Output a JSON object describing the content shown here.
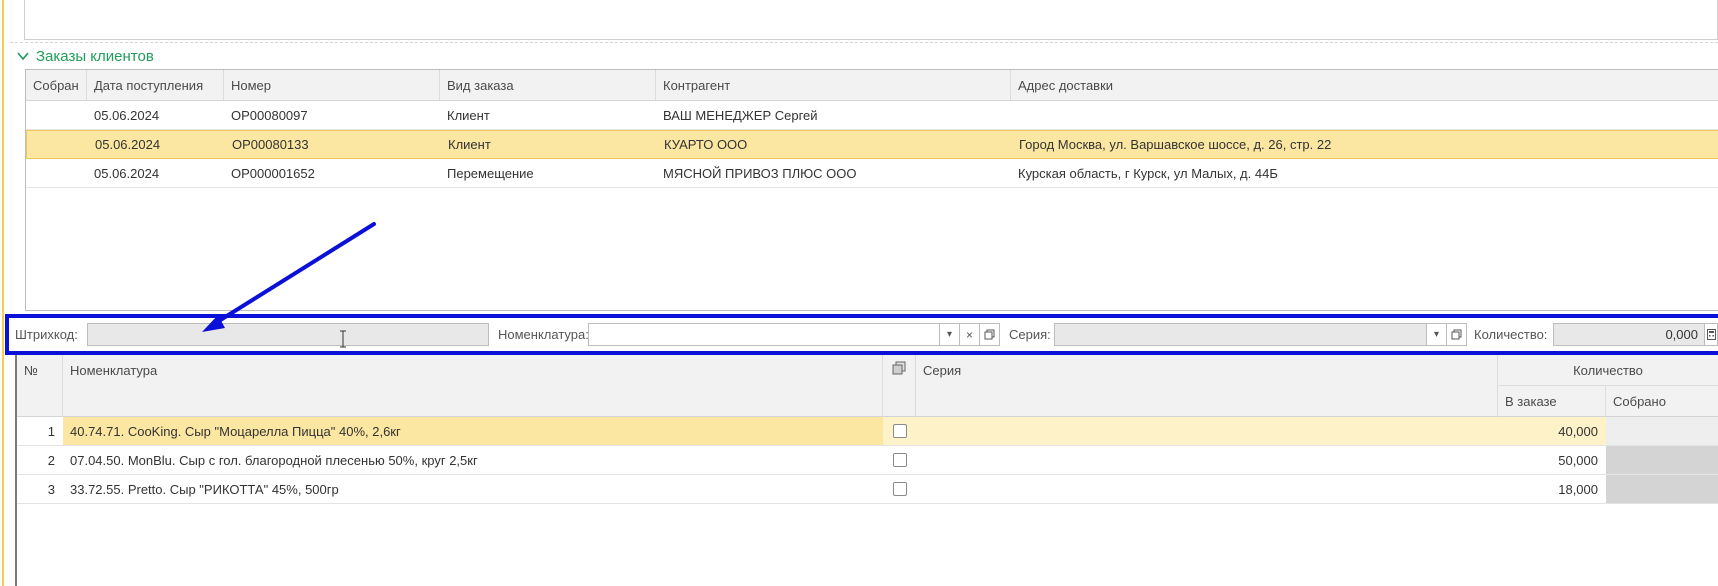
{
  "colors": {
    "accent_green": "#1e9e5a",
    "selection_yellow": "#fbe7a1",
    "highlight_blue": "#0a10d8"
  },
  "group": {
    "title": "Заказы клиентов"
  },
  "orders": {
    "columns": [
      "Собран",
      "Дата поступления",
      "Номер",
      "Вид заказа",
      "Контрагент",
      "Адрес доставки"
    ],
    "rows": [
      {
        "sobran": "",
        "date": "05.06.2024",
        "number": "ОР00080097",
        "type": "Клиент",
        "contractor": "ВАШ МЕНЕДЖЕР Сергей",
        "address": ""
      },
      {
        "sobran": "",
        "date": "05.06.2024",
        "number": "ОР00080133",
        "type": "Клиент",
        "contractor": "КУАРТО ООО",
        "address": "Город Москва, ул. Варшавское шоссе, д. 26, стр. 22"
      },
      {
        "sobran": "",
        "date": "05.06.2024",
        "number": "ОР000001652",
        "type": "Перемещение",
        "contractor": "МЯСНОЙ ПРИВОЗ ПЛЮС ООО",
        "address": "Курская область, г Курск, ул Малых, д. 44Б"
      }
    ],
    "selected_index": 1
  },
  "filter": {
    "barcode_label": "Штрихкод:",
    "barcode_value": "",
    "nomenclature_label": "Номенклатура:",
    "nomenclature_value": "",
    "series_label": "Серия:",
    "series_value": "",
    "quantity_label": "Количество:",
    "quantity_value": "0,000",
    "icons": [
      "chevron-down-icon",
      "clear-icon",
      "open-icon",
      "calculator-icon"
    ]
  },
  "items": {
    "col_num": "№",
    "col_nomenclature": "Номенклатура",
    "col_series": "Серия",
    "col_quantity": "Количество",
    "col_in_order": "В заказе",
    "col_collected": "Собрано",
    "rows": [
      {
        "num": "1",
        "nomenclature": "40.74.71. CooKing. Сыр \"Моцарелла Пицца\" 40%, 2,6кг",
        "series": "",
        "in_order": "40,000",
        "collected": ""
      },
      {
        "num": "2",
        "nomenclature": "07.04.50. MonBlu. Сыр с гол. благородной плесенью 50%, круг 2,5кг",
        "series": "",
        "in_order": "50,000",
        "collected": ""
      },
      {
        "num": "3",
        "nomenclature": "33.72.55. Pretto. Сыр \"РИКОТТА\" 45%, 500гр",
        "series": "",
        "in_order": "18,000",
        "collected": ""
      }
    ],
    "selected_index": 0
  }
}
